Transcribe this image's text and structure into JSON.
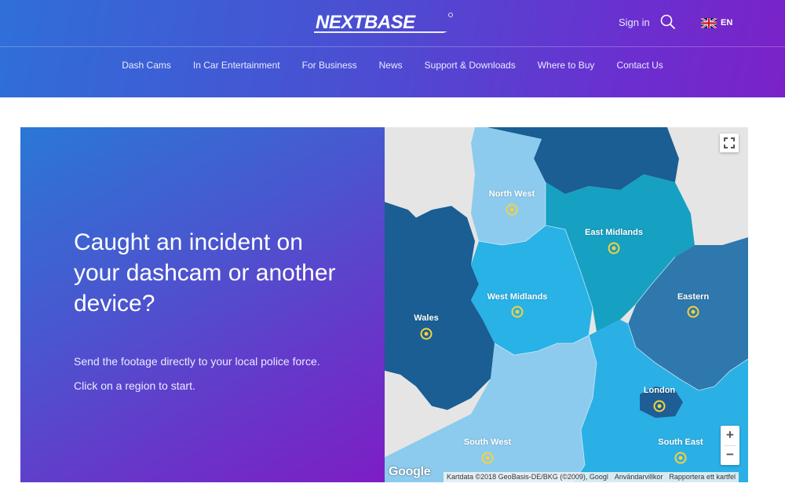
{
  "header": {
    "logo_text": "NEXTBASE",
    "sign_in": "Sign in",
    "language": "EN",
    "nav": [
      "Dash Cams",
      "In Car Entertainment",
      "For Business",
      "News",
      "Support & Downloads",
      "Where to Buy",
      "Contact Us"
    ]
  },
  "hero": {
    "title": "Caught an incident on your dashcam or another device?",
    "description": "Send the footage directly to your local police force.",
    "cta": "Click on a region to start."
  },
  "map": {
    "regions": [
      {
        "name": "North West",
        "color": "#8ccbee"
      },
      {
        "name": "East Midlands",
        "color": "#16a0c2"
      },
      {
        "name": "West Midlands",
        "color": "#28b2e6"
      },
      {
        "name": "Eastern",
        "color": "#2f78ad"
      },
      {
        "name": "Wales",
        "color": "#1a5e93"
      },
      {
        "name": "London",
        "color": "#1e5e94"
      },
      {
        "name": "South West",
        "color": "#8ccbee"
      },
      {
        "name": "South East",
        "color": "#2bb0e6"
      }
    ],
    "marker_color": "#f6d23c",
    "google_label": "Google",
    "attribution": "Kartdata ©2018 GeoBasis-DE/BKG (©2009), Googl",
    "terms": "Användarvillkor",
    "report": "Rapportera ett kartfel",
    "zoom_in": "+",
    "zoom_out": "−"
  },
  "colors": {
    "header_gradient_start": "#2f6fd8",
    "header_gradient_end": "#7a22c8",
    "sea": "#e5e5e5",
    "yorkshire": "#1a5e93"
  }
}
